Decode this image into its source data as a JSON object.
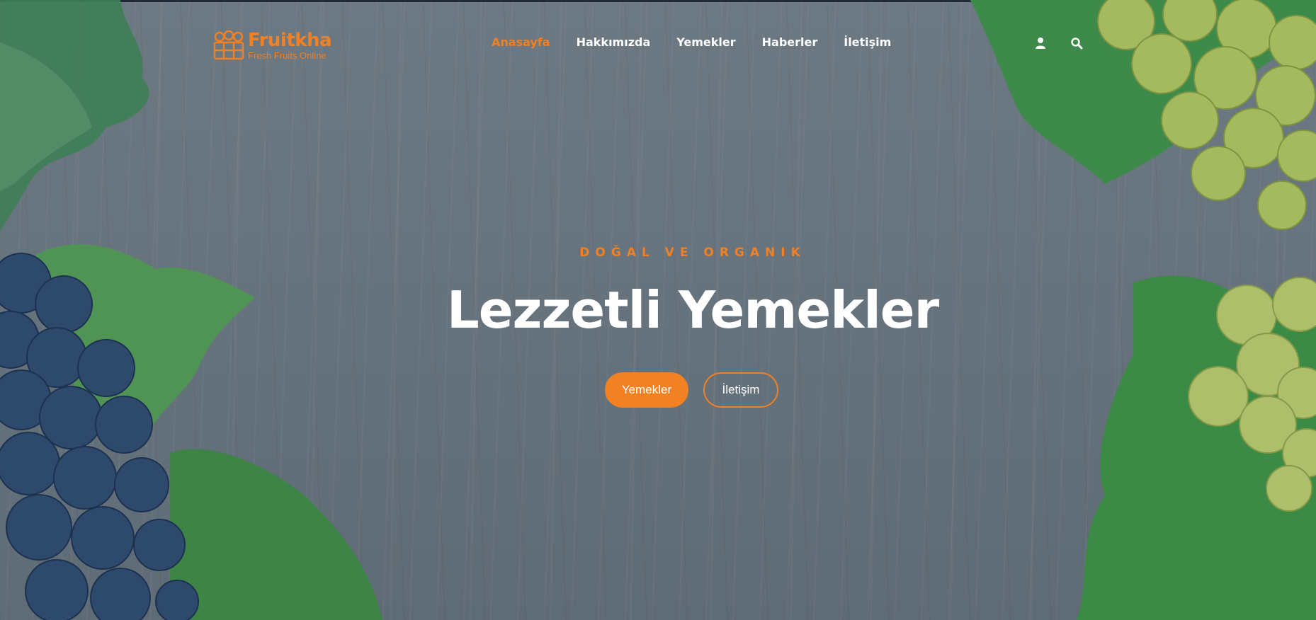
{
  "brand": {
    "name": "Fruitkha",
    "tagline": "Fresh Fruits Online",
    "accent_color": "#f28123",
    "icon": "fruit-crate-icon"
  },
  "nav": {
    "items": [
      {
        "label": "Anasayfa",
        "active": true
      },
      {
        "label": "Hakkımızda",
        "active": false
      },
      {
        "label": "Yemekler",
        "active": false
      },
      {
        "label": "Haberler",
        "active": false
      },
      {
        "label": "İletişim",
        "active": false
      }
    ],
    "icons": [
      "user-icon",
      "search-icon"
    ]
  },
  "hero": {
    "subtitle": "DOĞAL VE ORGANIK",
    "title": "Lezzetli Yemekler",
    "primary_button": "Yemekler",
    "secondary_button": "İletişim"
  },
  "colors": {
    "background": "#6b7781",
    "text": "#ffffff",
    "accent": "#f28123"
  }
}
